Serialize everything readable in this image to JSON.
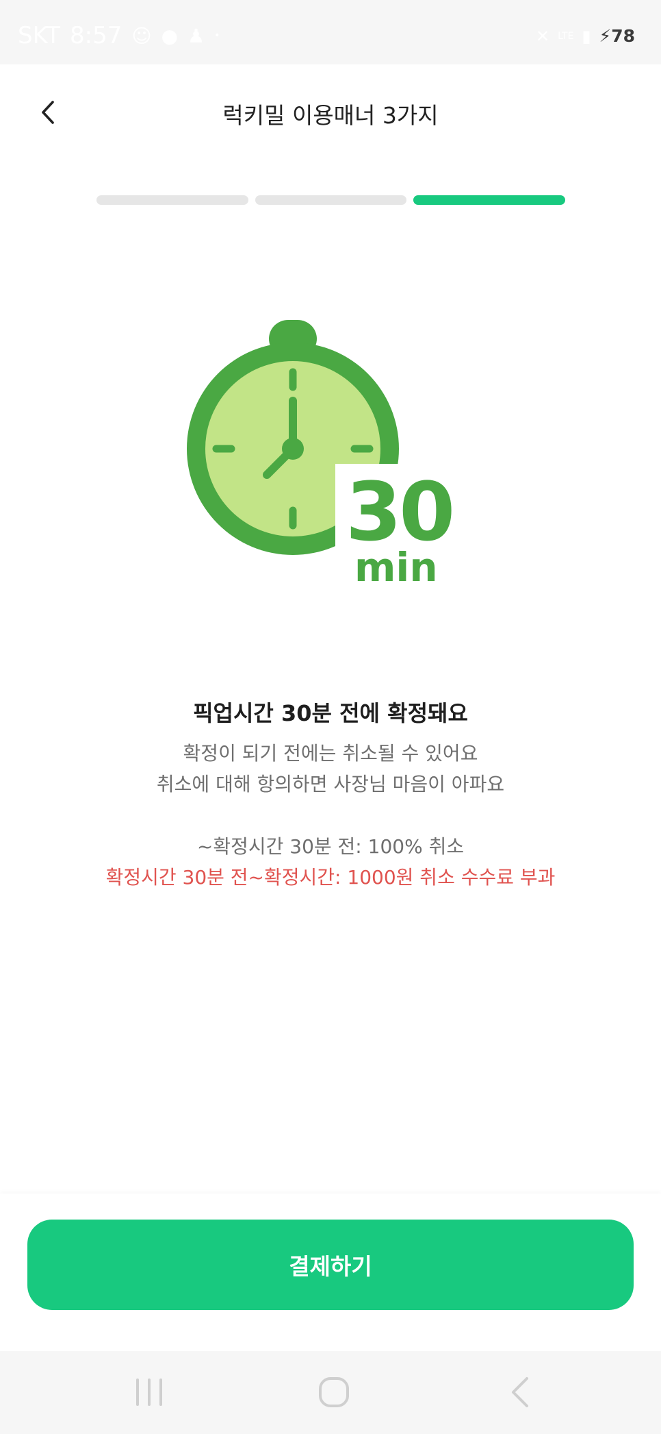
{
  "status_bar": {
    "carrier": "SKT",
    "time": "8:57",
    "signal_label": "LTE",
    "battery": "78"
  },
  "header": {
    "title": "럭키밀 이용매너 3가지",
    "back_icon": "chevron-left-icon"
  },
  "progress": {
    "total_steps": 3,
    "current_step": 3,
    "active_color": "#18c97f",
    "inactive_color": "#e6e6e6"
  },
  "illustration": {
    "icon": "stopwatch-icon",
    "number": "30",
    "unit": "min"
  },
  "content": {
    "heading": "픽업시간 30분 전에 확정돼요",
    "line1": "확정이 되기 전에는 취소될 수 있어요",
    "line2": "취소에 대해 항의하면 사장님 마음이 아파요",
    "policy_free": "~확정시간 30분 전: 100% 취소",
    "policy_fee": "확정시간 30분 전~확정시간: 1000원 취소 수수료 부과"
  },
  "colors": {
    "accent": "#18c97f",
    "warning": "#e0534f",
    "illustration_dark": "#4aa843",
    "illustration_light": "#c2e487"
  },
  "action": {
    "pay_label": "결제하기"
  },
  "nav": {
    "recent_icon": "recent-apps-icon",
    "home_icon": "home-icon",
    "back_icon": "back-icon"
  }
}
